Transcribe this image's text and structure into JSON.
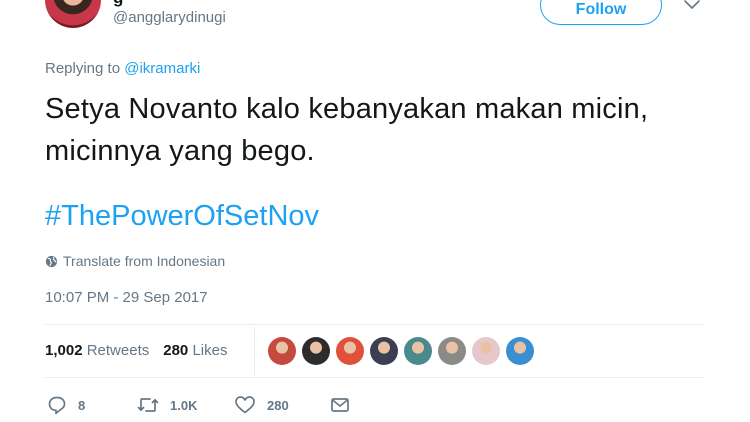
{
  "author": {
    "name_stub": "g",
    "handle": "@angglarydinugi"
  },
  "header": {
    "follow_label": "Follow"
  },
  "reply": {
    "prefix": "Replying to ",
    "handle": "@ikramarki"
  },
  "tweet": {
    "text": "Setya Novanto kalo kebanyakan makan micin, micinnya yang bego.",
    "hashtag": "#ThePowerOfSetNov",
    "translate_label": "Translate from Indonesian",
    "timestamp": "10:07 PM - 29 Sep 2017"
  },
  "stats": {
    "retweets_count": "1,002",
    "retweets_label": "Retweets",
    "likes_count": "280",
    "likes_label": "Likes"
  },
  "likers": {
    "avatar_colors": [
      "#c44a3d",
      "#2d2d2d",
      "#e1503a",
      "#3b3f52",
      "#4a8a8c",
      "#8a8a86",
      "#e5c7cc",
      "#3a8fd0"
    ]
  },
  "actions": {
    "reply_count": "8",
    "retweet_count": "1.0K",
    "like_count": "280"
  },
  "colors": {
    "accent": "#1da1f2",
    "muted": "#657786",
    "text": "#14171a"
  }
}
